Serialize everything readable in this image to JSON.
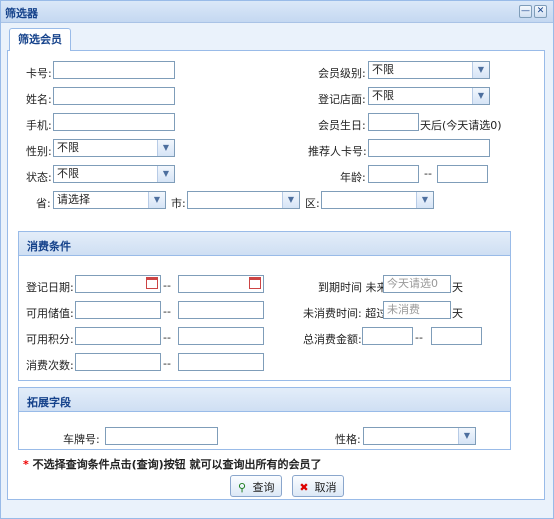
{
  "window": {
    "title": "筛选器"
  },
  "tab": {
    "label": "筛选会员"
  },
  "member": {
    "card_label": "卡号:",
    "name_label": "姓名:",
    "phone_label": "手机:",
    "gender_label": "性别:",
    "gender_value": "不限",
    "status_label": "状态:",
    "status_value": "不限",
    "province_label": "省:",
    "province_value": "请选择",
    "city_label": "市:",
    "district_label": "区:",
    "level_label": "会员级别:",
    "level_value": "不限",
    "store_label": "登记店面:",
    "store_value": "不限",
    "birthday_label": "会员生日:",
    "birthday_suffix": "天后(今天请选0)",
    "referrer_label": "推荐人卡号:",
    "age_label": "年龄:",
    "range_sep": "--"
  },
  "consume": {
    "title": "消费条件",
    "reg_date_label": "登记日期:",
    "balance_label": "可用储值:",
    "points_label": "可用积分:",
    "count_label": "消费次数:",
    "expire_label": "到期时间 未来",
    "expire_placeholder": "今天请选0",
    "days_unit": "天",
    "no_consume_label": "未消费时间: 超过",
    "no_consume_placeholder": "未消费",
    "total_label": "总消费金额:",
    "range_sep": "--"
  },
  "extend": {
    "title": "拓展字段",
    "plate_label": "车牌号:",
    "personality_label": "性格:"
  },
  "note": {
    "star": "*",
    "text": " 不选择查询条件点击(查询)按钮 就可以查询出所有的会员了"
  },
  "buttons": {
    "query": "查询",
    "cancel": "取消"
  },
  "colors": {
    "accent": "#15428b",
    "border": "#99bbe8",
    "warning": "#e00000"
  }
}
